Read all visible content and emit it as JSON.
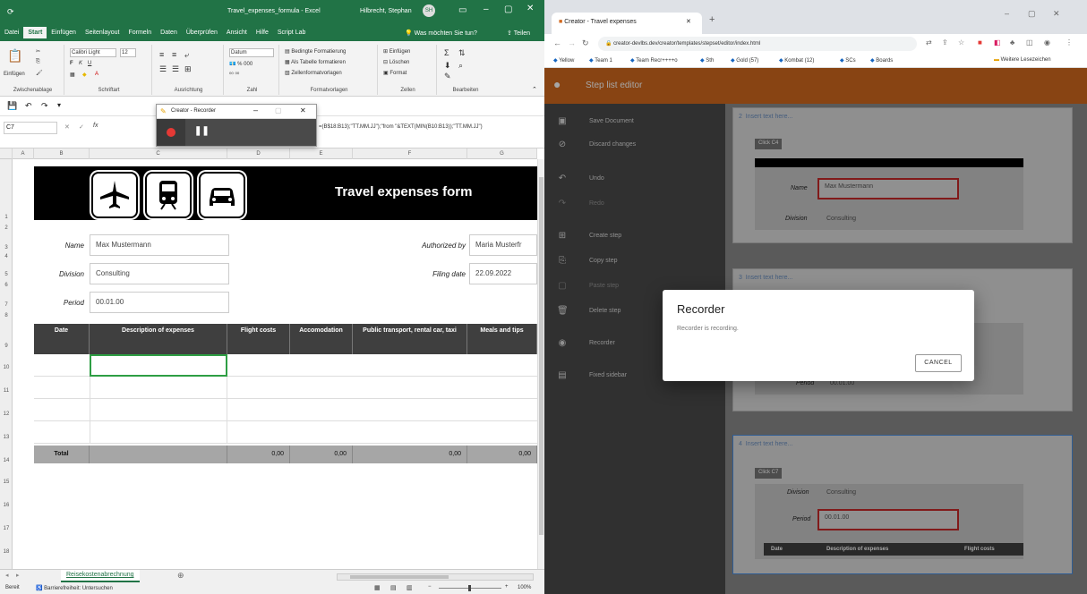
{
  "excel": {
    "title": "Travel_expenses_formula - Excel",
    "user": "Hilbrecht, Stephan",
    "user_initials": "SH",
    "tabs": [
      "Datei",
      "Start",
      "Einfügen",
      "Seitenlayout",
      "Formeln",
      "Daten",
      "Überprüfen",
      "Ansicht",
      "Hilfe",
      "Script Lab"
    ],
    "tell_me": "Was möchten Sie tun?",
    "share": "Teilen",
    "ribbon": {
      "paste": "Einfügen",
      "clipboard": "Zwischenablage",
      "font_name": "Calibri Light",
      "font_size": "12",
      "font_group": "Schriftart",
      "align_group": "Ausrichtung",
      "number_format": "Datum",
      "number_group": "Zahl",
      "cond_format": "Bedingte Formatierung",
      "as_table": "Als Tabelle formatieren",
      "cell_styles": "Zellenformatvorlagen",
      "styles_group": "Formatvorlagen",
      "insert": "Einfügen",
      "delete": "Löschen",
      "format": "Format",
      "cells_group": "Zellen",
      "edit_group": "Bearbeiten"
    },
    "name_box": "C7",
    "formula": "=(B$18:B13);\"TT.MM.JJ\");\"from \"&TEXT(MIN(B10:B13));\"TT.MM.JJ\")",
    "columns": [
      "A",
      "B",
      "C",
      "D",
      "E",
      "F",
      "G"
    ],
    "rows": [
      "1",
      "2",
      "3",
      "4",
      "5",
      "6",
      "7",
      "8",
      "9",
      "10",
      "11",
      "12",
      "13",
      "14",
      "15",
      "16",
      "17",
      "18"
    ],
    "form_title": "Travel expenses form",
    "labels": {
      "name": "Name",
      "division": "Division",
      "period": "Period",
      "authorized_by": "Authorized by",
      "filing_date": "Filing date"
    },
    "values": {
      "name": "Max Mustermann",
      "division": "Consulting",
      "period": "00.01.00",
      "authorized_by": "Maria Musterfr",
      "filing_date": "22.09.2022"
    },
    "table_headers": [
      "Date",
      "Description of expenses",
      "Flight costs",
      "Accomodation",
      "Public transport, rental car, taxi",
      "Meals and tips"
    ],
    "total_label": "Total",
    "totals": [
      "0,00",
      "0,00",
      "0,00",
      "0,00"
    ],
    "sheet_tab": "Reisekostenabrechnung",
    "status": "Bereit",
    "accessibility": "Barrierefreiheit: Untersuchen",
    "zoom": "100%"
  },
  "recorder_mini": {
    "title": "Creator - Recorder"
  },
  "chrome": {
    "tab_title": "Creator - Travel expenses",
    "url": "creator-devlbs.dev/creator/templates/stepset/editor/index.html",
    "bookmarks": [
      "Yellow",
      "Team 1",
      "Team Recr++++o",
      "Sth",
      "Gold (57)",
      "Kombat (12)",
      "SCs",
      "Boards"
    ],
    "other_bookmarks": "Weitere Lesezeichen",
    "app_title": "Step list editor",
    "sidebar": [
      {
        "label": "Save Document",
        "icon": "save-icon"
      },
      {
        "label": "Discard changes",
        "icon": "block-icon"
      },
      {
        "label": "Undo",
        "icon": "undo-icon"
      },
      {
        "label": "Redo",
        "icon": "redo-icon"
      },
      {
        "label": "Create step",
        "icon": "plus-box-icon"
      },
      {
        "label": "Copy step",
        "icon": "copy-icon"
      },
      {
        "label": "Paste step",
        "icon": "paste-icon"
      },
      {
        "label": "Delete step",
        "icon": "trash-icon"
      },
      {
        "label": "Recorder",
        "icon": "record-icon"
      },
      {
        "label": "Fixed sidebar",
        "icon": "pin-icon"
      }
    ],
    "steps": [
      {
        "number": "2",
        "placeholder": "Insert text here...",
        "chip": "Click C4",
        "field_label": "Name",
        "field_value": "Max Mustermann",
        "below_label": "Division",
        "below_value": "Consulting"
      },
      {
        "number": "3",
        "placeholder": "Insert text here...",
        "field_label": "Period",
        "field_value": "00.01.00"
      },
      {
        "number": "4",
        "placeholder": "Insert text here...",
        "chip": "Click C7",
        "above_label": "Division",
        "above_value": "Consulting",
        "field_label": "Period",
        "field_value": "00.01.00",
        "table_headers": [
          "Date",
          "Description of expenses",
          "Flight costs"
        ]
      }
    ]
  },
  "modal": {
    "title": "Recorder",
    "message": "Recorder is recording.",
    "cancel": "CANCEL"
  },
  "colors": {
    "excel_green": "#217346",
    "app_orange": "#d2691e",
    "sidebar": "#4a4a4a",
    "highlight_red": "#c62828"
  }
}
